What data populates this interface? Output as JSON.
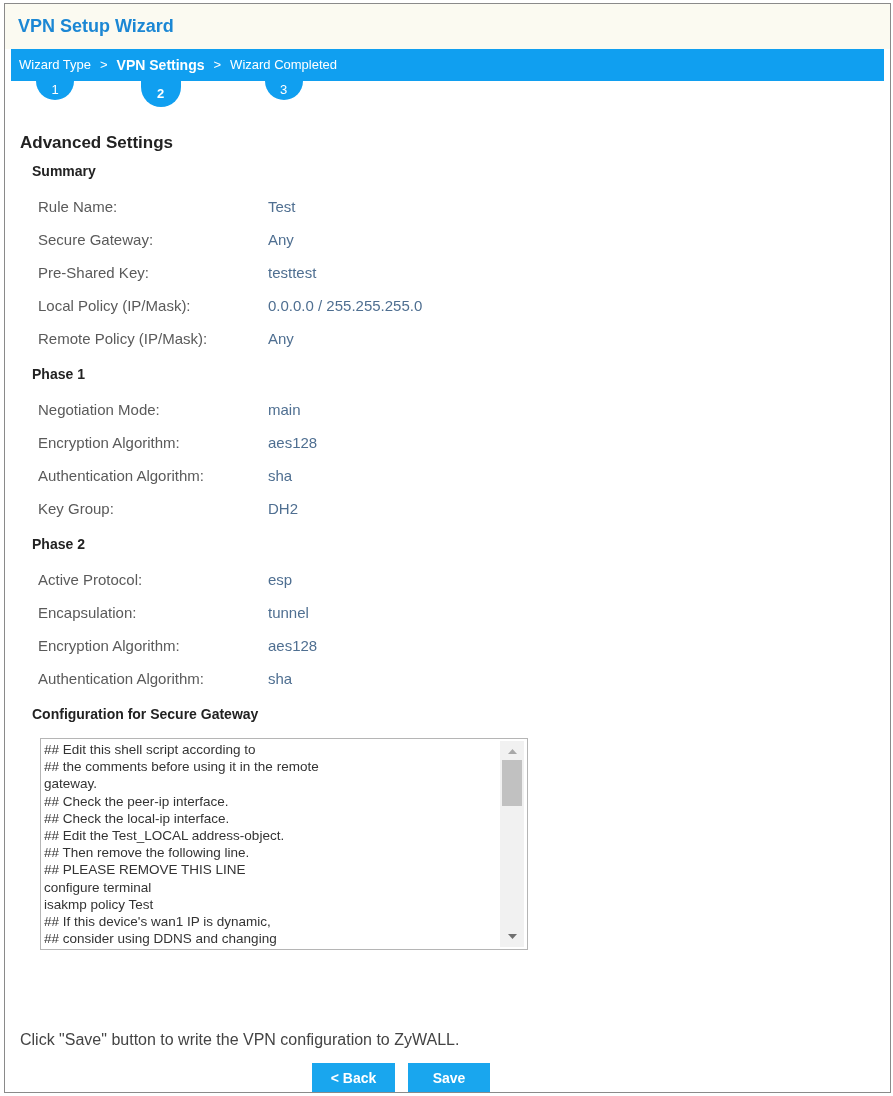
{
  "window": {
    "title": "VPN Setup Wizard"
  },
  "wizard_steps": [
    {
      "kind": "step",
      "label": "Wizard Type",
      "number": "1",
      "selected": false
    },
    {
      "kind": "separator",
      "text": ">"
    },
    {
      "kind": "step",
      "label": "VPN Settings",
      "number": "2",
      "selected": true
    },
    {
      "kind": "separator",
      "text": ">"
    },
    {
      "kind": "step",
      "label": "Wizard Completed",
      "number": "3",
      "selected": false
    }
  ],
  "heading": "Advanced Settings",
  "sections": [
    {
      "title": "Summary",
      "fields": [
        {
          "label": "Rule Name:",
          "value": "Test"
        },
        {
          "label": "Secure Gateway:",
          "value": "Any"
        },
        {
          "label": "Pre-Shared Key:",
          "value": "testtest"
        },
        {
          "label": "Local Policy (IP/Mask):",
          "value": "0.0.0.0 / 255.255.255.0"
        },
        {
          "label": "Remote Policy (IP/Mask):",
          "value": "Any"
        }
      ]
    },
    {
      "title": "Phase 1",
      "fields": [
        {
          "label": "Negotiation Mode:",
          "value": "main"
        },
        {
          "label": "Encryption Algorithm:",
          "value": "aes128"
        },
        {
          "label": "Authentication Algorithm:",
          "value": "sha"
        },
        {
          "label": "Key Group:",
          "value": "DH2"
        }
      ]
    },
    {
      "title": "Phase 2",
      "fields": [
        {
          "label": "Active Protocol:",
          "value": "esp"
        },
        {
          "label": "Encapsulation:",
          "value": "tunnel"
        },
        {
          "label": "Encryption Algorithm:",
          "value": "aes128"
        },
        {
          "label": "Authentication Algorithm:",
          "value": "sha"
        }
      ]
    }
  ],
  "config": {
    "title": "Configuration for Secure Gateway",
    "lines": [
      "## Edit this shell script according to",
      "## the comments before using it in the remote",
      "gateway.",
      "## Check the peer-ip interface.",
      "## Check the local-ip interface.",
      "## Edit the Test_LOCAL address-object.",
      "## Then remove the following line.",
      "## PLEASE REMOVE THIS LINE",
      "configure terminal",
      "isakmp policy Test",
      "## If this device's wan1 IP is dynamic,",
      "## consider using DDNS and changing"
    ]
  },
  "footer_note": "Click \"Save\" button to write the VPN configuration to ZyWALL.",
  "buttons": [
    "< Back",
    "Save"
  ]
}
